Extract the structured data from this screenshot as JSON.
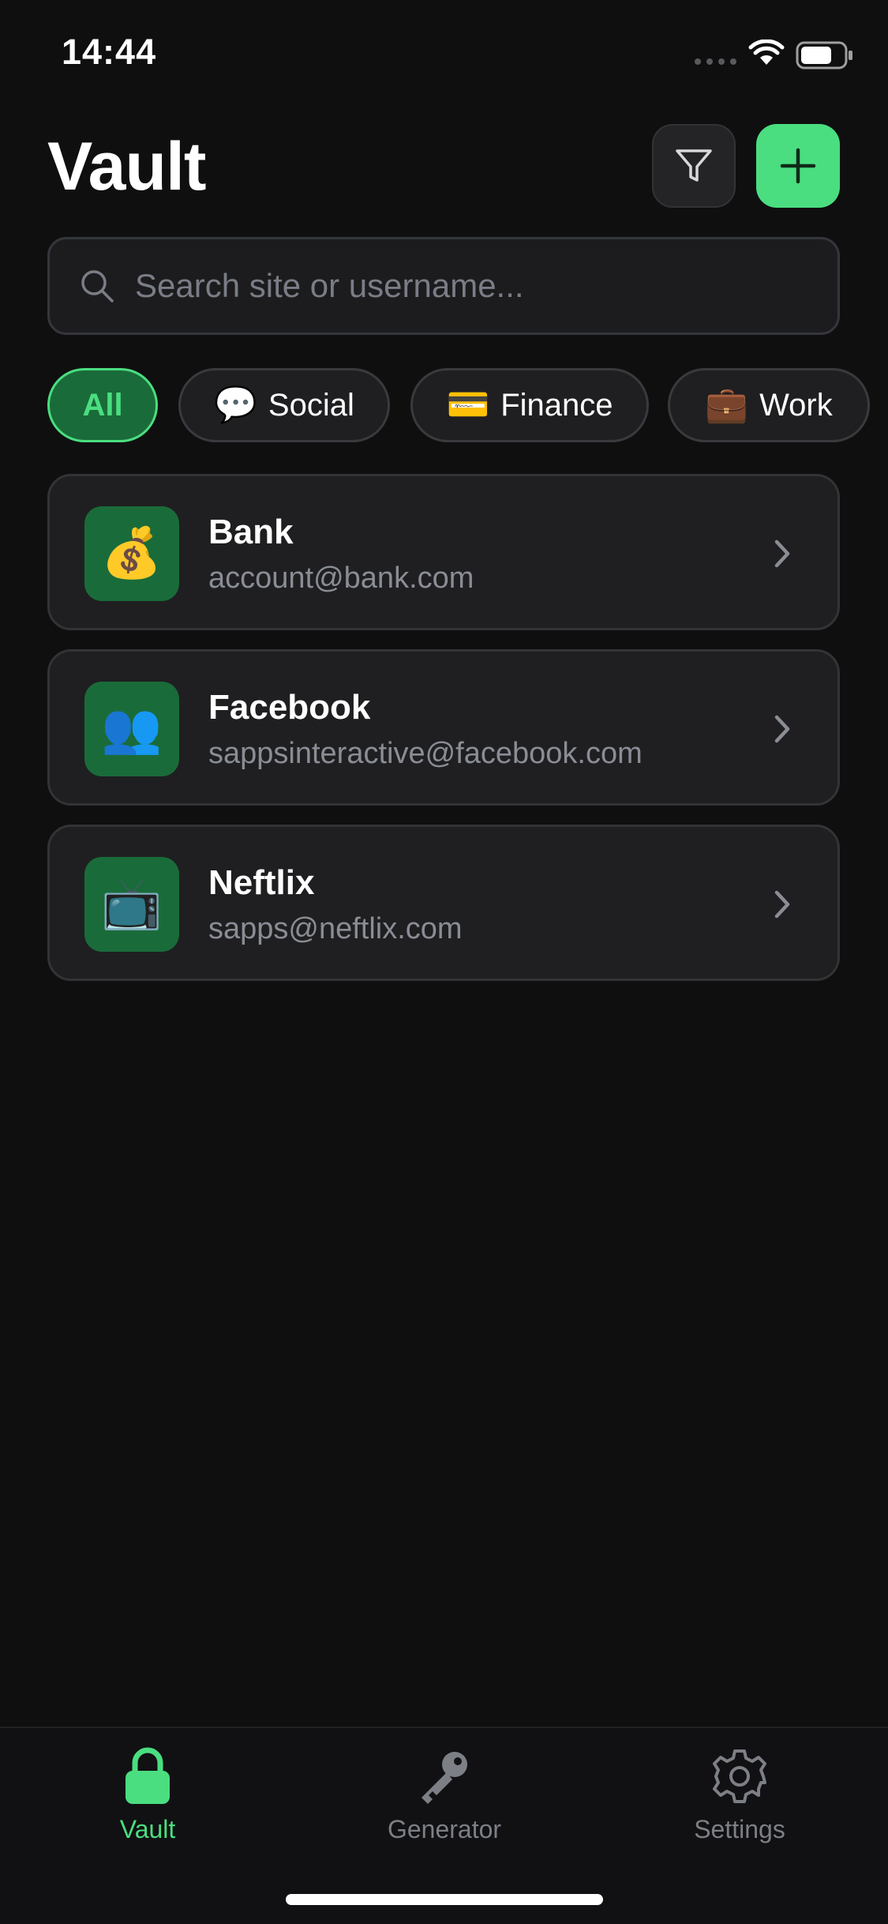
{
  "status_bar": {
    "time": "14:44"
  },
  "header": {
    "title": "Vault"
  },
  "search": {
    "placeholder": "Search site or username..."
  },
  "categories": [
    {
      "label": "All",
      "emoji": "",
      "active": true
    },
    {
      "label": "Social",
      "emoji": "💬",
      "active": false
    },
    {
      "label": "Finance",
      "emoji": "💳",
      "active": false
    },
    {
      "label": "Work",
      "emoji": "💼",
      "active": false
    }
  ],
  "accounts": [
    {
      "name": "Bank",
      "username": "account@bank.com",
      "emoji": "💰"
    },
    {
      "name": "Facebook",
      "username": "sappsinteractive@facebook.com",
      "emoji": "👥"
    },
    {
      "name": "Neftlix",
      "username": "sapps@neftlix.com",
      "emoji": "📺"
    }
  ],
  "tabs": [
    {
      "label": "Vault",
      "icon": "lock-icon",
      "active": true
    },
    {
      "label": "Generator",
      "icon": "key-icon",
      "active": false
    },
    {
      "label": "Settings",
      "icon": "gear-icon",
      "active": false
    }
  ],
  "colors": {
    "accent": "#4ade80",
    "accent_dark": "#1a6b3a",
    "background": "#0f0f10",
    "card": "#1f1f21"
  }
}
